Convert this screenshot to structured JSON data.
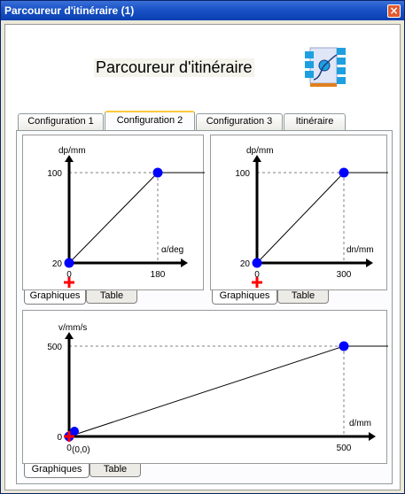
{
  "window": {
    "title": "Parcoureur d'itinéraire (1)",
    "close_icon": "close-icon"
  },
  "heading": "Parcoureur d'itinéraire",
  "tabs": [
    "Configuration 1",
    "Configuration 2",
    "Configuration 3",
    "Itinéraire"
  ],
  "active_tab": 1,
  "subtabs": [
    "Graphiques",
    "Table"
  ],
  "colors": {
    "point": "#0000ff",
    "marker": "#ff0000",
    "line": "#000000",
    "guide": "#808080"
  },
  "chart_data": [
    {
      "type": "line",
      "ylabel": "dp/mm",
      "xlabel": "α/deg",
      "y_ticks": [
        "100",
        "20"
      ],
      "x_ticks": [
        "0",
        "180"
      ],
      "points": [
        [
          0,
          20
        ],
        [
          180,
          100
        ]
      ],
      "flat_after": 100
    },
    {
      "type": "line",
      "ylabel": "dp/mm",
      "xlabel": "dn/mm",
      "y_ticks": [
        "100",
        "20"
      ],
      "x_ticks": [
        "0",
        "300"
      ],
      "points": [
        [
          0,
          20
        ],
        [
          300,
          100
        ]
      ],
      "flat_after": 100
    },
    {
      "type": "line",
      "ylabel": "v/mm/s",
      "xlabel": "d/mm",
      "y_ticks": [
        "500",
        "0"
      ],
      "x_ticks": [
        "0",
        "500"
      ],
      "origin_label": "(0,0)",
      "points": [
        [
          0,
          0
        ],
        [
          500,
          500
        ]
      ],
      "flat_after": 500
    }
  ]
}
